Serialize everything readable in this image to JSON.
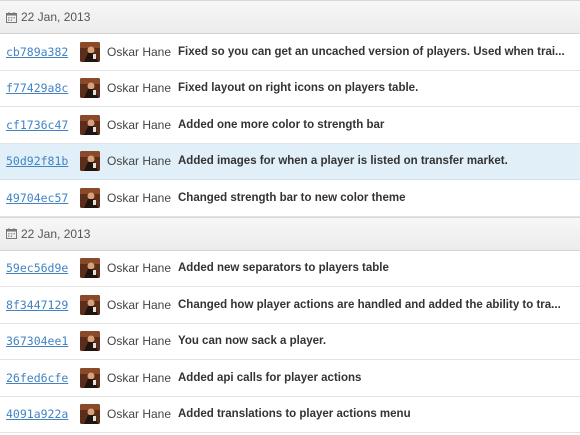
{
  "groups": [
    {
      "date": "22 Jan, 2013",
      "commits": [
        {
          "sha": "cb789a382",
          "author": "Oskar Hane",
          "message": "Fixed so you can get an uncached version of players. Used when trai..."
        },
        {
          "sha": "f77429a8c",
          "author": "Oskar Hane",
          "message": "Fixed layout on right icons on players table."
        },
        {
          "sha": "cf1736c47",
          "author": "Oskar Hane",
          "message": "Added one more color to strength bar"
        },
        {
          "sha": "50d92f81b",
          "author": "Oskar Hane",
          "message": "Added images for when a player is listed on transfer market."
        },
        {
          "sha": "49704ec57",
          "author": "Oskar Hane",
          "message": "Changed strength bar to new color theme"
        }
      ]
    },
    {
      "date": "22 Jan, 2013",
      "commits": [
        {
          "sha": "59ec56d9e",
          "author": "Oskar Hane",
          "message": "Added new separators to players table"
        },
        {
          "sha": "8f3447129",
          "author": "Oskar Hane",
          "message": "Changed how player actions are handled and added the ability to tra..."
        },
        {
          "sha": "367304ee1",
          "author": "Oskar Hane",
          "message": "You can now sack a player."
        },
        {
          "sha": "26fed6cfe",
          "author": "Oskar Hane",
          "message": "Added api calls for player actions"
        },
        {
          "sha": "4091a922a",
          "author": "Oskar Hane",
          "message": "Added translations to player actions menu"
        }
      ]
    }
  ],
  "icons": {
    "date": "calendar-icon",
    "avatar": "author-avatar"
  },
  "colors": {
    "sha_link": "#4183c4",
    "highlight_row": "#e1f0f8",
    "header_bg": "#ececec"
  }
}
